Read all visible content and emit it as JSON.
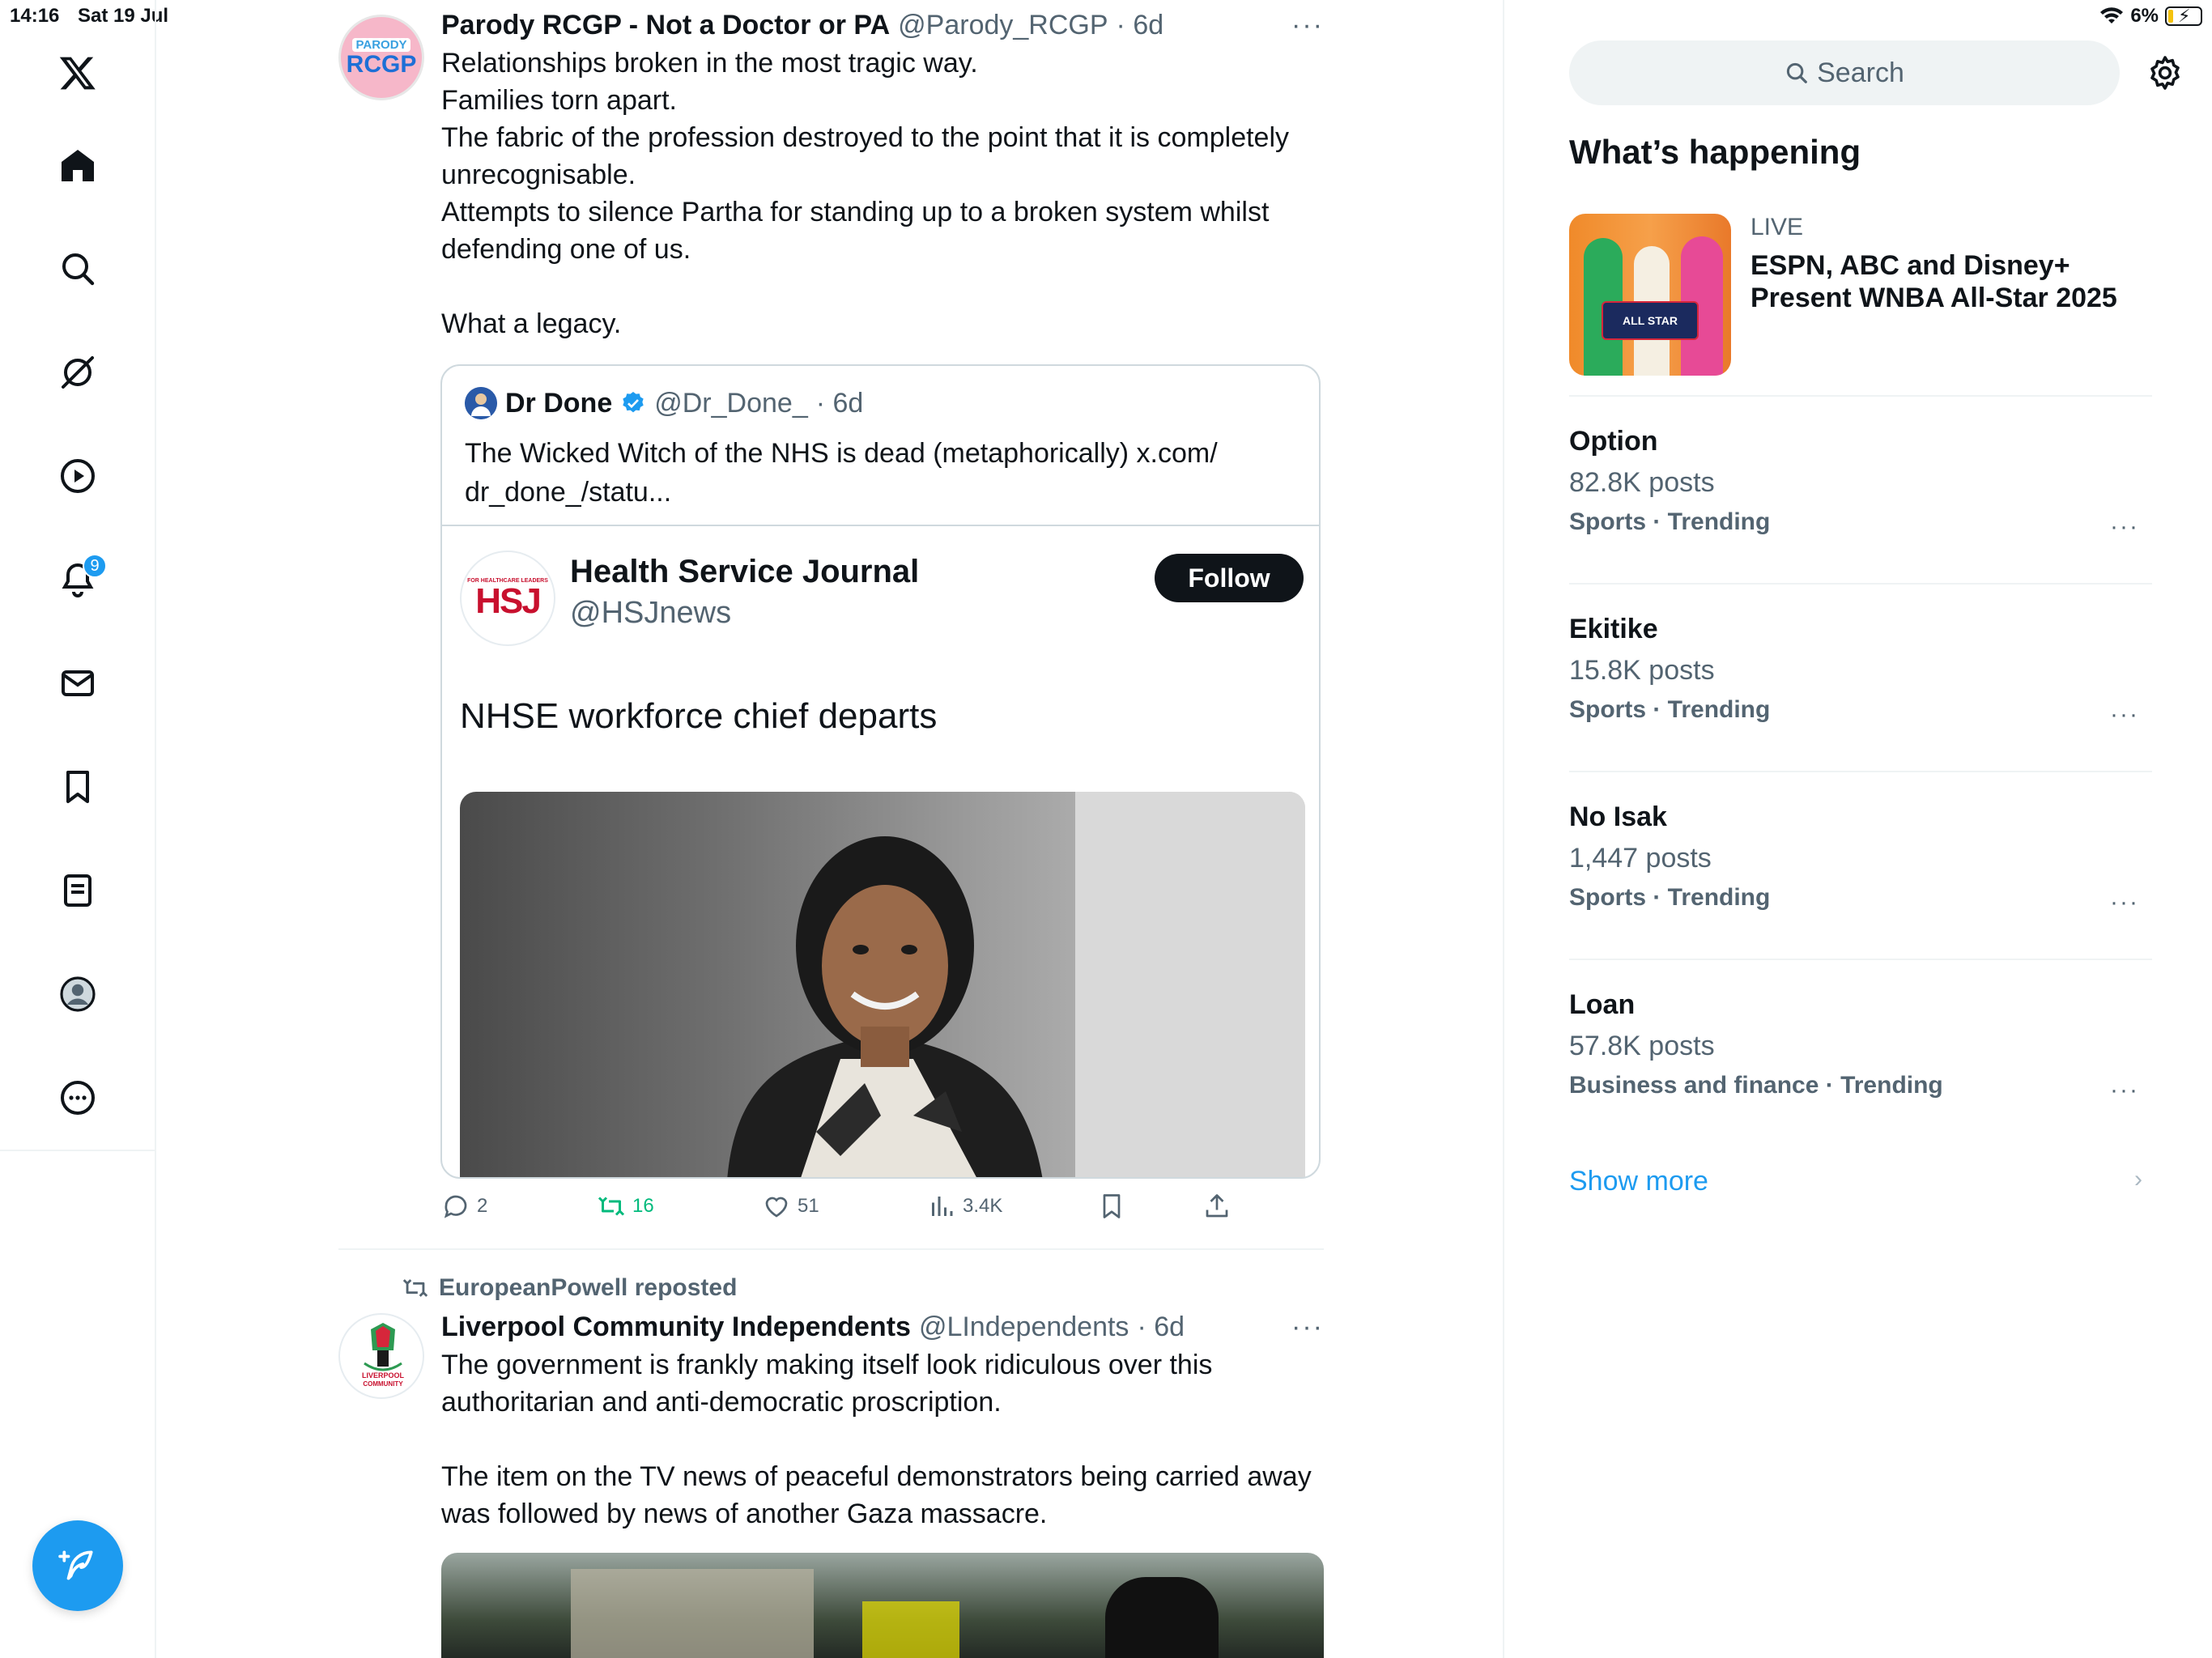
{
  "status": {
    "time": "14:16",
    "date": "Sat 19 Jul",
    "battery": "6%"
  },
  "nav": {
    "notifications_badge": "9",
    "items": [
      "x-logo",
      "home",
      "explore",
      "grok",
      "video",
      "notifications",
      "messages",
      "bookmarks",
      "lists",
      "profile",
      "more"
    ]
  },
  "tweet1": {
    "name": "Parody RCGP - Not a Doctor or PA",
    "handle": "@Parody_RCGP",
    "time": "· 6d",
    "avatar_top": "PARODY",
    "avatar_main": "RCGP",
    "text": "Relationships broken in the most tragic way.\nFamilies torn apart.\nThe fabric of the profession destroyed to the point that it is completely unrecognisable.\nAttempts to silence Partha for standing up to a broken system whilst defending one of us.\n\nWhat a legacy.",
    "quote": {
      "name": "Dr Done",
      "handle": "@Dr_Done_",
      "time": "· 6d",
      "text": "The Wicked Witch of the NHS is dead (metaphorically) x.com/\ndr_done_/statu...",
      "card": {
        "avatar_small": "FOR HEALTHCARE LEADERS",
        "avatar_big": "HSJ",
        "name": "Health Service Journal",
        "handle": "@HSJnews",
        "follow_label": "Follow",
        "headline": "NHSE workforce chief departs"
      }
    },
    "actions": {
      "replies": "2",
      "reposts": "16",
      "likes": "51",
      "views": "3.4K"
    }
  },
  "tweet2": {
    "repost_label": "EuropeanPowell reposted",
    "name": "Liverpool Community Independents",
    "handle": "@LIndependents",
    "time": "· 6d",
    "text": "The government is frankly making itself look ridiculous over this authoritarian and anti-democratic proscription.\n\nThe item on the TV news of peaceful demonstrators being carried away was followed by news of another Gaza massacre."
  },
  "sidebar": {
    "search_placeholder": "Search",
    "section_title": "What’s happening",
    "live": {
      "label": "LIVE",
      "title": "ESPN, ABC and Disney+ Present WNBA All-Star 2025",
      "thumb_logo": "ALL STAR"
    },
    "trends": [
      {
        "name": "Option",
        "count": "82.8K posts",
        "category": "Sports · Trending"
      },
      {
        "name": "Ekitike",
        "count": "15.8K posts",
        "category": "Sports · Trending"
      },
      {
        "name": "No Isak",
        "count": "1,447 posts",
        "category": "Sports · Trending"
      },
      {
        "name": "Loan",
        "count": "57.8K posts",
        "category": "Business and finance · Trending"
      }
    ],
    "show_more": "Show more"
  },
  "colors": {
    "accent": "#1d9bf0",
    "repost_green": "#00ba7c",
    "text_primary": "#0f1419",
    "text_secondary": "#536471"
  }
}
